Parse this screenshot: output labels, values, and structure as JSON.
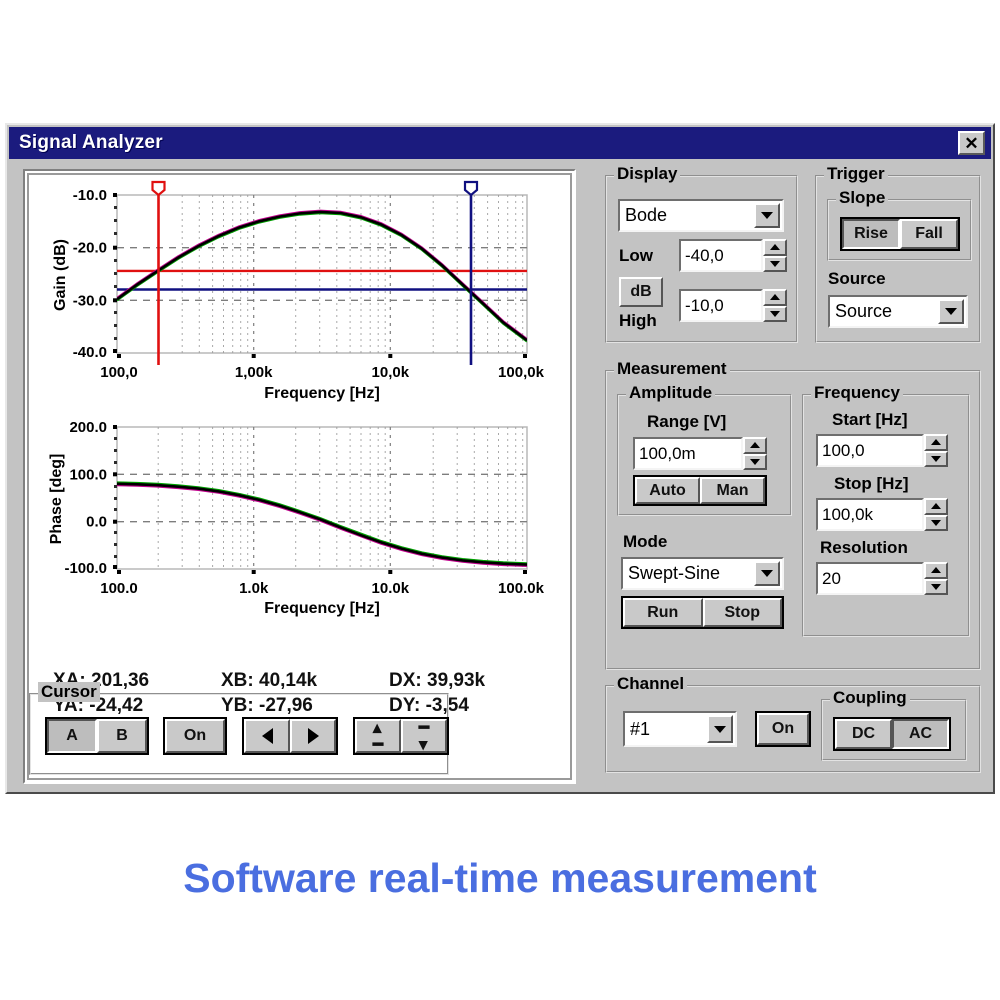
{
  "window": {
    "title": "Signal Analyzer",
    "close_icon": "close-x-icon"
  },
  "caption": "Software real-time measurement",
  "readout": {
    "xa": "XA: 201,36",
    "xb": "XB: 40,14k",
    "dx": "DX: 39,93k",
    "ya": "YA: -24,42",
    "yb": "YB: -27,96",
    "dy": "DY: -3,54"
  },
  "display": {
    "group_label": "Display",
    "mode_value": "Bode",
    "low_label": "Low",
    "low_value": "-40,0",
    "db_label": "dB",
    "high_label": "High",
    "high_value": "-10,0"
  },
  "trigger": {
    "group_label": "Trigger",
    "slope_label": "Slope",
    "rise_label": "Rise",
    "fall_label": "Fall",
    "source_label": "Source",
    "source_value": "Source"
  },
  "measurement": {
    "group_label": "Measurement",
    "amplitude_label": "Amplitude",
    "range_label": "Range [V]",
    "range_value": "100,0m",
    "auto_label": "Auto",
    "man_label": "Man",
    "mode_label": "Mode",
    "mode_value": "Swept-Sine",
    "run_label": "Run",
    "stop_label": "Stop"
  },
  "frequency": {
    "group_label": "Frequency",
    "start_label": "Start [Hz]",
    "start_value": "100,0",
    "stop_label": "Stop [Hz]",
    "stop_value": "100,0k",
    "resolution_label": "Resolution",
    "resolution_value": "20"
  },
  "cursor": {
    "group_label": "Cursor",
    "a_label": "A",
    "b_label": "B",
    "on_label": "On",
    "left_icon": "arrow-left-icon",
    "right_icon": "arrow-right-icon",
    "up_icon": "double-arrow-up-icon",
    "down_icon": "double-arrow-down-icon"
  },
  "channel": {
    "group_label": "Channel",
    "channel_value": "#1",
    "on_label": "On",
    "coupling_label": "Coupling",
    "dc_label": "DC",
    "ac_label": "AC"
  },
  "colors": {
    "titlebar": "#1b1b7e",
    "face": "#c3c3c3",
    "cursor_a": "#e01010",
    "cursor_b": "#101080",
    "caption": "#4a6ee0",
    "trace_black": "#000000",
    "trace_green": "#00a000",
    "trace_magenta": "#c0008c"
  },
  "chart_data": [
    {
      "type": "line",
      "id": "gain",
      "title": "",
      "xlabel": "Frequency [Hz]",
      "ylabel": "Gain (dB)",
      "xscale": "log",
      "xlim": [
        100,
        100000
      ],
      "ylim": [
        -40,
        -10
      ],
      "yticks": [
        -10.0,
        -20.0,
        -30.0,
        -40.0
      ],
      "yticklabels": [
        "-10.0",
        "-20.0",
        "-30.0",
        "-40.0"
      ],
      "xticks": [
        100,
        1000,
        10000,
        100000
      ],
      "xticklabels": [
        "100,0",
        "1,00k",
        "10,0k",
        "100,0k"
      ],
      "grid": true,
      "legend": false,
      "series": [
        {
          "name": "Gain",
          "x": [
            100,
            141,
            200,
            282,
            400,
            565,
            800,
            1130,
            1600,
            2260,
            3200,
            4500,
            6400,
            9000,
            12800,
            18000,
            25600,
            36000,
            50000,
            71000,
            100000
          ],
          "y": [
            -29.8,
            -27.0,
            -24.4,
            -21.9,
            -19.7,
            -17.8,
            -16.2,
            -15.0,
            -14.1,
            -13.5,
            -13.2,
            -13.4,
            -14.2,
            -15.6,
            -17.6,
            -20.2,
            -23.4,
            -27.0,
            -30.6,
            -34.2,
            -37.6
          ]
        }
      ],
      "cursors": [
        {
          "name": "A",
          "color": "#e01010",
          "x": 201.36,
          "y": -24.42
        },
        {
          "name": "B",
          "color": "#101080",
          "x": 40140,
          "y": -27.96
        }
      ]
    },
    {
      "type": "line",
      "id": "phase",
      "title": "",
      "xlabel": "Frequency [Hz]",
      "ylabel": "Phase [deg]",
      "xscale": "log",
      "xlim": [
        100,
        100000
      ],
      "ylim": [
        -100,
        200
      ],
      "yticks": [
        200.0,
        100.0,
        0.0,
        -100.0
      ],
      "yticklabels": [
        "200.0",
        "100.0",
        "0.0",
        "-100.0"
      ],
      "xticks": [
        100,
        1000,
        10000,
        100000
      ],
      "xticklabels": [
        "100.0",
        "1.0k",
        "10.0k",
        "100.0k"
      ],
      "grid": true,
      "legend": false,
      "series": [
        {
          "name": "Phase",
          "x": [
            100,
            141,
            200,
            282,
            400,
            565,
            800,
            1130,
            1600,
            2260,
            3200,
            4500,
            6400,
            9000,
            12800,
            18000,
            25600,
            36000,
            50000,
            71000,
            100000
          ],
          "y": [
            80,
            79,
            77,
            74,
            70,
            64,
            56,
            46,
            34,
            20,
            5,
            -12,
            -28,
            -43,
            -56,
            -67,
            -75,
            -81,
            -85,
            -88,
            -90
          ]
        }
      ]
    }
  ]
}
